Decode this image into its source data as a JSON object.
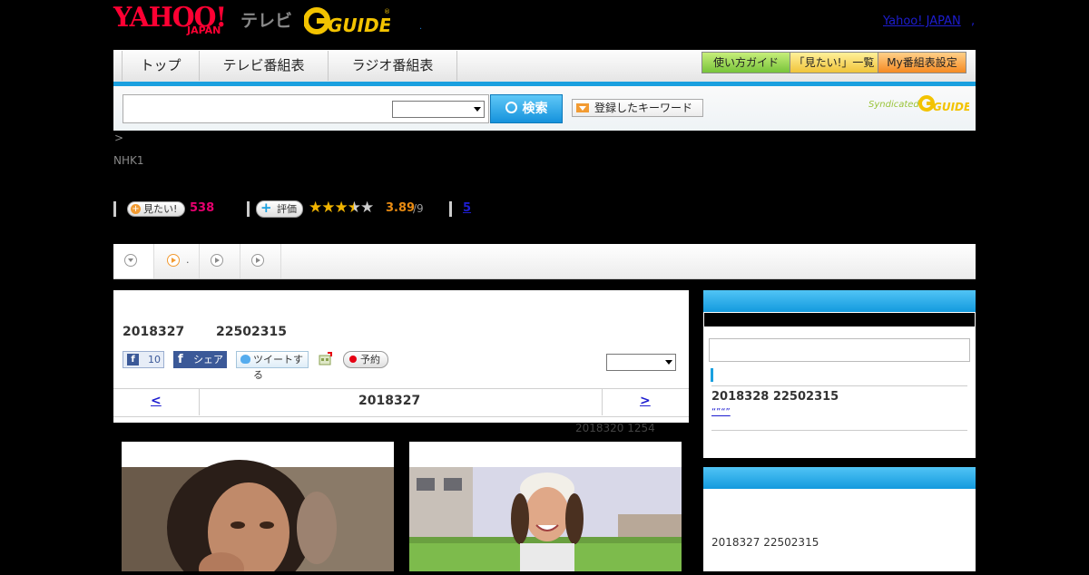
{
  "header": {
    "logo_yahoo": "YAHOO!",
    "logo_japan": "JAPAN",
    "logo_tv": "テレビ",
    "logo_gguide": "G GUIDE",
    "logo_dot": ".",
    "yahoo_japan_link": "Yahoo! JAPAN",
    "comma": ","
  },
  "nav": {
    "tabs": [
      "トップ",
      "テレビ番組表",
      "ラジオ番組表"
    ],
    "guide_button": "使い方ガイド",
    "mitai_list_button": "「見たい!」一覧",
    "my_schedule_button": "My番組表設定"
  },
  "search": {
    "button_label": "検索",
    "keyword_button": "登録したキーワード",
    "syndicated": "Syndicated",
    "syndicated_logo": "G GUIDE"
  },
  "program": {
    "breadcrumb": ">",
    "channel": "NHK1",
    "mitai_label": "見たい!",
    "mitai_count": "538",
    "rating_label": "評価",
    "stars_filled": 3.5,
    "stars_total": 5,
    "rating_value": "3.89",
    "rating_count": "/9",
    "review_link": "5"
  },
  "tabs": [
    {
      "label": ""
    },
    {
      "label": "."
    },
    {
      "label": ""
    },
    {
      "label": ""
    }
  ],
  "episode": {
    "date": "2018327",
    "time": "22502315",
    "like_count": "10",
    "share_label": "シェア",
    "tweet_label": "ツイートする",
    "reserve_label": "予約",
    "nav_prev": "<",
    "nav_date": "2018327",
    "nav_next": ">",
    "update_note": "2018320  1254"
  },
  "sidebar": {
    "program_line": "2018328  22502315",
    "link_text": "“”“”",
    "box2_text": "2018327  22502315"
  },
  "colors": {
    "accent_blue": "#1aa0df",
    "link": "#1d1dd0",
    "mitai_pink": "#e6006e",
    "rating_orange": "#e98b12",
    "yahoo_red": "#ff0033"
  }
}
